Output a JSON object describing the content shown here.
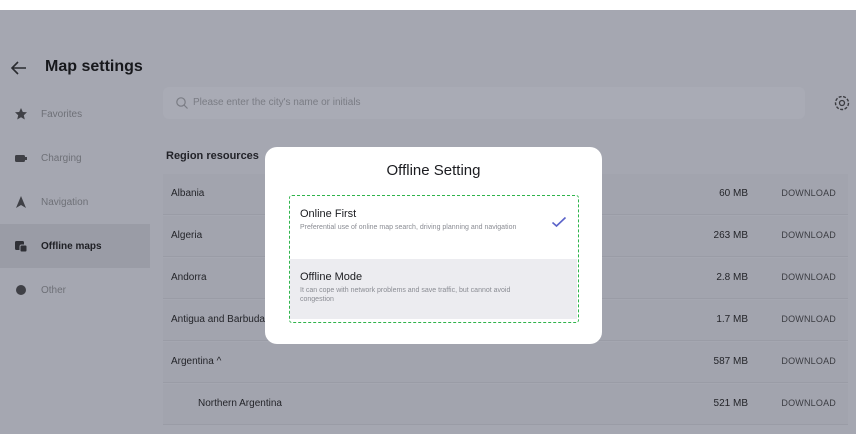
{
  "header": {
    "title": "Map settings"
  },
  "sidebar": {
    "items": [
      {
        "label": "Favorites",
        "icon": "star-icon"
      },
      {
        "label": "Charging",
        "icon": "charging-icon"
      },
      {
        "label": "Navigation",
        "icon": "navigation-arrow-icon"
      },
      {
        "label": "Offline maps",
        "icon": "offline-maps-icon",
        "active": true
      },
      {
        "label": "Other",
        "icon": "other-dot-icon"
      }
    ]
  },
  "search": {
    "placeholder": "Please enter the city's name or initials"
  },
  "region": {
    "title": "Region resources",
    "download_label": "DOWNLOAD",
    "rows": [
      {
        "name": "Albania",
        "size": "60 MB"
      },
      {
        "name": "Algeria",
        "size": "263 MB"
      },
      {
        "name": "Andorra",
        "size": "2.8 MB"
      },
      {
        "name": "Antigua and Barbuda",
        "size": "1.7 MB"
      },
      {
        "name": "Argentina ^",
        "size": "587 MB"
      },
      {
        "name": "Northern Argentina",
        "size": "521 MB"
      }
    ]
  },
  "modal": {
    "title": "Offline Setting",
    "options": [
      {
        "title": "Online First",
        "desc": "Preferential use of online map search, driving planning and navigation",
        "selected": true
      },
      {
        "title": "Offline Mode",
        "desc": "It can cope with network problems and save traffic, but cannot avoid congestion",
        "selected": false
      }
    ]
  },
  "colors": {
    "accent_check": "#5b63c9",
    "dashed_border": "#2fb44b",
    "overlay": "#a5a7b1"
  }
}
